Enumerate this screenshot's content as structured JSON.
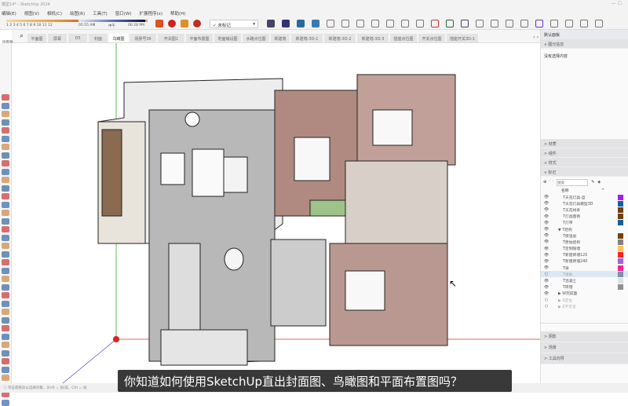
{
  "titlebar": {
    "title": "模型14* - SketchUp 2024",
    "controls": "—   ☐"
  },
  "menu": [
    "编辑(E)",
    "视图(V)",
    "相机(C)",
    "绘图(R)",
    "工具(T)",
    "窗口(W)",
    "扩展程序(x)",
    "帮助(H)"
  ],
  "toolbar": {
    "month_scale": "1 2 3 4 5 6 7 8 9 10 11 12",
    "time_start": "05:55 AM",
    "time_mid": "中午",
    "time_end": "06:28 PM",
    "tag_dropdown": "✓ 未标记"
  },
  "scenes": {
    "search_label": "场景图",
    "tabs": [
      "平面图",
      "屏幕",
      "D5",
      "封面",
      "鸟瞰图",
      "场景号36",
      "开关图1",
      "平面布置图",
      "地面铺设图",
      "水路点位图",
      "新建墙",
      "新建墙-3D-1",
      "新建墙-3D-2",
      "新建墙-3D-3",
      "插座点位图",
      "开关点位图",
      "插座开关3D-1"
    ],
    "active": 4
  },
  "panel": {
    "title": "默认面板",
    "entity_info": "图元信息",
    "no_selection": "没有选择内容",
    "sections_top": [
      "材质",
      "组件",
      "样式",
      "标记"
    ],
    "search_placeholder": "搜索",
    "column_name": "名称",
    "tags": [
      {
        "name": "T天花灯具-蓝",
        "color": "#a020f0",
        "visible": true,
        "indent": 1
      },
      {
        "name": "T天花灯具模型3D",
        "color": "#1060a0",
        "visible": true,
        "indent": 1
      },
      {
        "name": "T天花线条",
        "color": "#704010",
        "visible": true,
        "indent": 1
      },
      {
        "name": "T灯具图例",
        "color": "#704010",
        "visible": true,
        "indent": 1
      },
      {
        "name": "T灯带",
        "color": "#1060a0",
        "visible": true,
        "indent": 1
      },
      {
        "name": "▼ T结构",
        "color": "",
        "visible": true,
        "indent": 0
      },
      {
        "name": "T保温层",
        "color": "#704010",
        "visible": true,
        "indent": 1
      },
      {
        "name": "T原始结构",
        "color": "#808080",
        "visible": true,
        "indent": 1
      },
      {
        "name": "T定制隔墙",
        "color": "#ffc060",
        "visible": true,
        "indent": 1
      },
      {
        "name": "T新建砖墙120",
        "color": "#ff2020",
        "visible": true,
        "indent": 1
      },
      {
        "name": "T新建砖墙240",
        "color": "#a060e0",
        "visible": true,
        "indent": 1
      },
      {
        "name": "T梁",
        "color": "#ff2090",
        "visible": true,
        "indent": 1
      },
      {
        "name": "T楼板",
        "color": "#8090b0",
        "visible": false,
        "indent": 1
      },
      {
        "name": "T混凝土",
        "color": "#e0e0e0",
        "visible": true,
        "indent": 1
      },
      {
        "name": "T砖墙",
        "color": "#909090",
        "visible": true,
        "indent": 1
      },
      {
        "name": "▶ W完成面",
        "color": "",
        "visible": true,
        "indent": 0
      },
      {
        "name": "▶ X定位",
        "color": "",
        "visible": false,
        "indent": 0
      },
      {
        "name": "▶ Z不可见",
        "color": "",
        "visible": false,
        "indent": 0
      }
    ],
    "sections_bottom": [
      "阴影",
      "场景",
      "工具向导"
    ]
  },
  "status": {
    "hint": "单击或拖动以选择对象。Shift = 加/减。Ctrl = 加"
  },
  "subtitle": "你知道如何使用SketchUp直出封面图、鸟瞰图和平面布置图吗？"
}
